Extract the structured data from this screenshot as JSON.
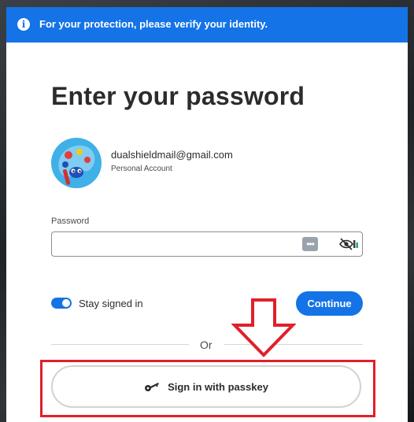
{
  "banner": {
    "text": "For your protection, please verify your identity.",
    "icon": "info-icon",
    "color": "#1473e6"
  },
  "main": {
    "title": "Enter your password"
  },
  "account": {
    "email": "dualshieldmail@gmail.com",
    "type": "Personal Account",
    "avatar": "avatar-image"
  },
  "password": {
    "label": "Password",
    "value": "",
    "manager_icon": "password-manager-icon",
    "visibility_icon": "hide-password-icon"
  },
  "stay_signed_in": {
    "label": "Stay signed in",
    "checked": true
  },
  "continue_button": {
    "label": "Continue"
  },
  "divider": {
    "text": "Or"
  },
  "passkey_button": {
    "label": "Sign in with passkey",
    "icon": "key-icon"
  },
  "annotation": {
    "arrow_color": "#e0202a",
    "box_color": "#e0202a"
  }
}
